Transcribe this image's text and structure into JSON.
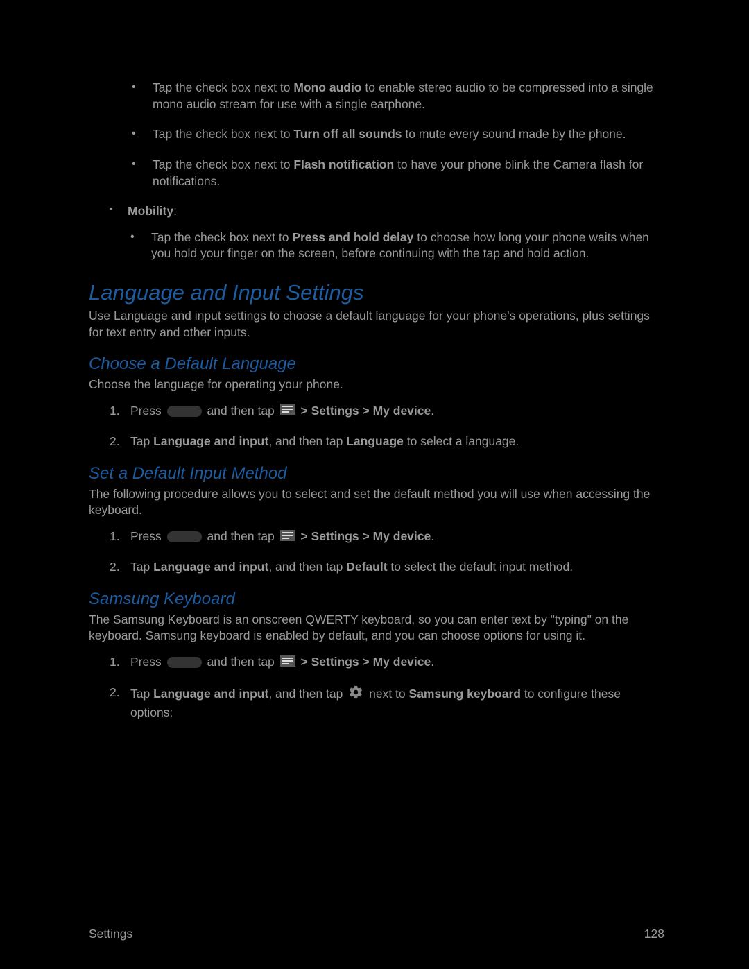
{
  "bullets_top": [
    {
      "pre": "Tap the check box next to ",
      "bold": "Mono audio",
      "post": " to enable stereo audio to be compressed into a single mono audio stream for use with a single earphone."
    },
    {
      "pre": "Tap the check box next to ",
      "bold": "Turn off all sounds",
      "post": " to mute every sound made by the phone."
    },
    {
      "pre": "Tap the check box next to ",
      "bold": "Flash notification",
      "post": " to have your phone blink the Camera flash for notifications."
    }
  ],
  "mobility_label": "Mobility",
  "mobility_bullet": {
    "pre": "Tap the check box next to ",
    "bold": "Press and hold delay",
    "post": " to choose how long your phone waits when you hold your finger on the screen, before continuing with the tap and hold action."
  },
  "h1": "Language and Input Settings",
  "h1_desc": "Use Language and input settings to choose a default language for your phone's operations, plus settings for text entry and other inputs.",
  "sections": {
    "choose_lang": {
      "title": "Choose a Default Language",
      "desc": "Choose the language for operating your phone.",
      "step1_press": "Press",
      "step1_then": " and then tap ",
      "step1_path": " > Settings > My device",
      "step1_dot": ".",
      "step2_pre": "Tap ",
      "step2_b1": "Language and input",
      "step2_mid": ", and then tap ",
      "step2_b2": "Language",
      "step2_post": " to select a language."
    },
    "default_input": {
      "title": "Set a Default Input Method",
      "desc": "The following procedure allows you to select and set the default method you will use when accessing the keyboard.",
      "step1_press": "Press",
      "step1_then": " and then tap ",
      "step1_path": " > Settings > My device",
      "step1_dot": ".",
      "step2_pre": "Tap ",
      "step2_b1": "Language and input",
      "step2_mid": ", and then tap ",
      "step2_b2": "Default",
      "step2_post": " to select the default input method."
    },
    "samsung_kbd": {
      "title": "Samsung Keyboard",
      "desc": "The Samsung Keyboard is an onscreen QWERTY keyboard, so you can enter text by \"typing\" on the keyboard. Samsung keyboard is enabled by default, and you can choose options for using it.",
      "step1_press": "Press",
      "step1_then": " and then tap ",
      "step1_path": " > Settings > My device",
      "step1_dot": ".",
      "step2_pre": "Tap ",
      "step2_b1": "Language and input",
      "step2_mid": ", and then tap ",
      "step2_next": " next to ",
      "step2_b2": "Samsung keyboard",
      "step2_post": " to configure these options:"
    }
  },
  "footer": {
    "left": "Settings",
    "right": "128"
  }
}
